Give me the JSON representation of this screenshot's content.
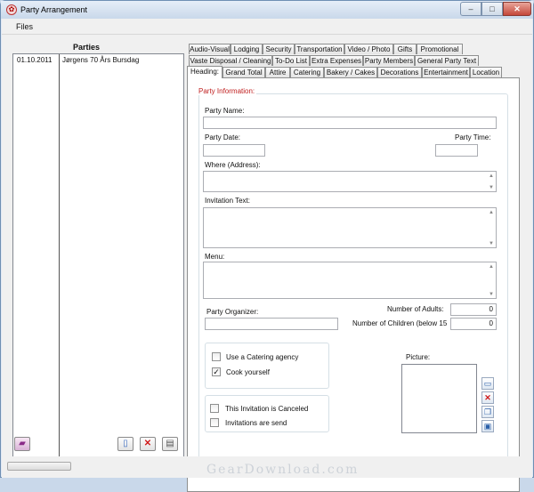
{
  "window": {
    "title": "Party Arrangement"
  },
  "menu": {
    "files": "Files"
  },
  "parties": {
    "title": "Parties",
    "rows": [
      {
        "date": "01.10.2011",
        "name": "Jørgens 70 Års Bursdag"
      }
    ]
  },
  "tabs": {
    "row1": [
      "Audio-Visual",
      "Lodging",
      "Security",
      "Transportation",
      "Video / Photo",
      "Gifts",
      "Promotional"
    ],
    "row2": [
      "Vaste Disposal / Cleaning",
      "To-Do List",
      "Extra Expenses",
      "Party Members",
      "General Party Text"
    ],
    "row3": [
      "Heading:",
      "Grand Total",
      "Attire",
      "Catering",
      "Bakery / Cakes",
      "Decorations",
      "Entertainment",
      "Location"
    ],
    "active": "Heading:"
  },
  "form": {
    "group_label": "Party Information:",
    "party_name_label": "Party Name:",
    "party_name": "",
    "party_date_label": "Party Date:",
    "party_date": "",
    "party_time_label": "Party Time:",
    "party_time": "",
    "address_label": "Where (Address):",
    "invitation_label": "Invitation Text:",
    "menu_label": "Menu:",
    "organizer_label": "Party Organizer:",
    "organizer": "",
    "adults_label": "Number of Adults:",
    "adults": "0",
    "children_label": "Number of Children (below 15",
    "children": "0",
    "catering_agency_label": "Use a Catering agency",
    "catering_agency": false,
    "cook_yourself_label": "Cook yourself",
    "cook_yourself": true,
    "canceled_label": "This Invitation is Canceled",
    "canceled": false,
    "invitations_sent_label": "Invitations are send",
    "invitations_sent": false,
    "picture_label": "Picture:"
  },
  "icons": {
    "add_party": "book-icon",
    "new": "new-document-icon",
    "delete": "delete-x-icon",
    "print": "printer-icon",
    "open_picture": "open-folder-icon",
    "remove_picture": "delete-x-icon",
    "copy_picture": "copy-icon",
    "paste_picture": "paste-icon"
  },
  "watermark": "GearDownload.com"
}
